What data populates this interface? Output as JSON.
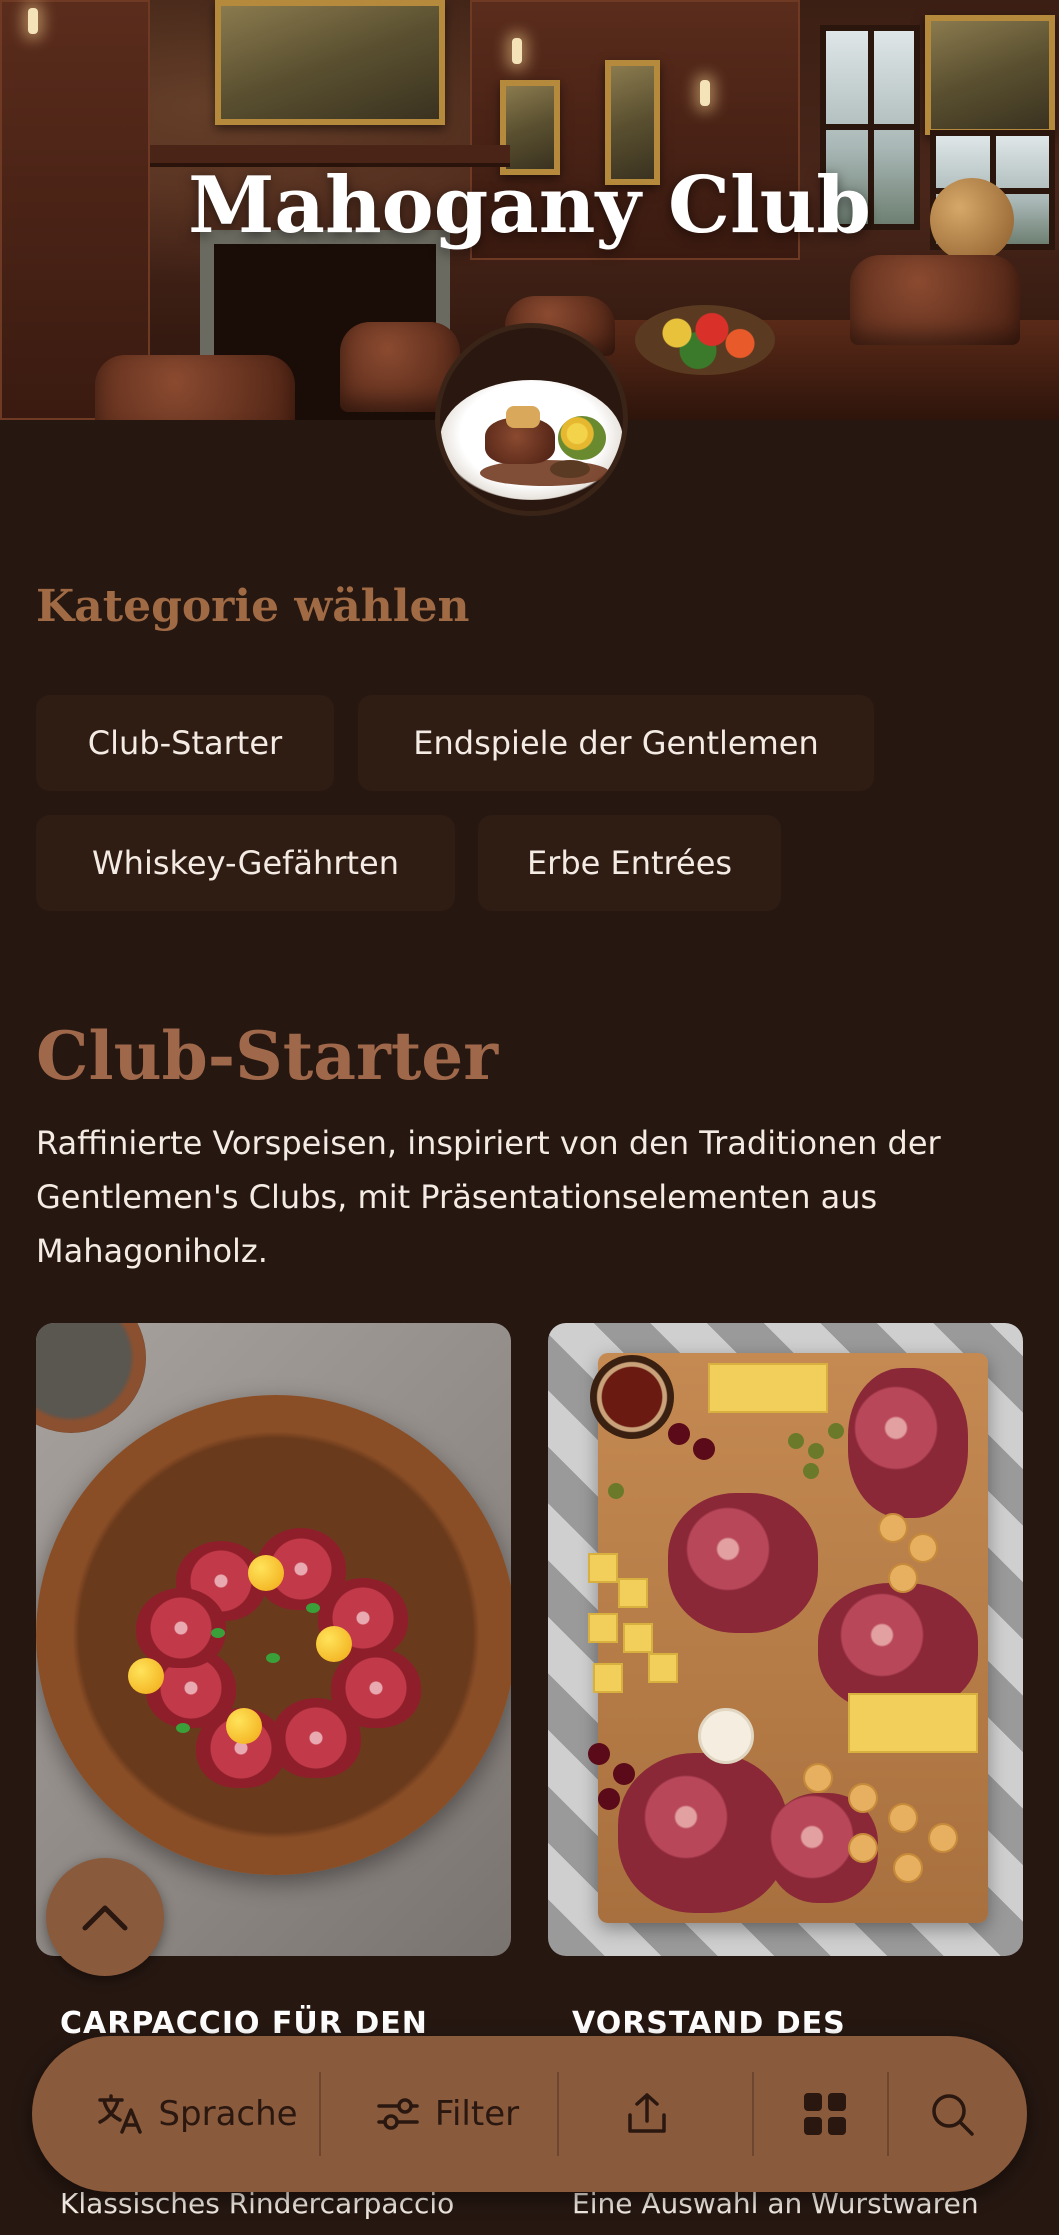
{
  "hero": {
    "title": "Mahogany Club"
  },
  "categories": {
    "heading": "Kategorie wählen",
    "items": [
      {
        "label": "Club-Starter"
      },
      {
        "label": "Endspiele der Gentlemen"
      },
      {
        "label": "Whiskey-Gefährten"
      },
      {
        "label": "Erbe Entrées"
      }
    ]
  },
  "section": {
    "title": "Club-Starter",
    "description": "Raffinierte Vorspeisen, inspiriert von den Traditionen der Gentlemen's Clubs, mit Präsentationselementen aus Mahagoniholz."
  },
  "products": [
    {
      "title": "CARPACCIO FÜR DEN",
      "description": "Klassisches Rindercarpaccio"
    },
    {
      "title": "VORSTAND DES",
      "description": "Eine Auswahl an Wurstwaren"
    }
  ],
  "toolbar": {
    "language_label": "Sprache",
    "filter_label": "Filter",
    "icons": [
      "translate-icon",
      "filter-sliders-icon",
      "share-icon",
      "grid-icon",
      "search-icon"
    ]
  },
  "colors": {
    "background": "#261711",
    "accent": "#8a5a3c",
    "heading": "#a06a44",
    "chip": "#2f1d14"
  }
}
